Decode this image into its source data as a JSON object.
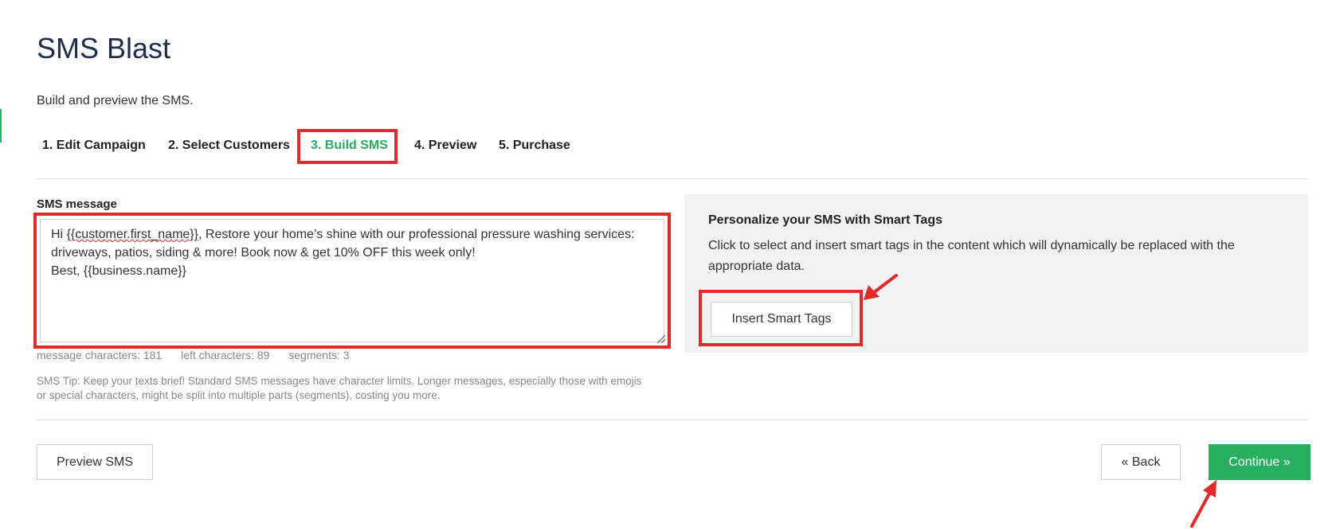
{
  "page": {
    "title": "SMS Blast",
    "subtitle": "Build and preview the SMS."
  },
  "steps": [
    {
      "label": "1. Edit Campaign",
      "active": false
    },
    {
      "label": "2. Select Customers",
      "active": false
    },
    {
      "label": "3. Build SMS",
      "active": true
    },
    {
      "label": "4. Preview",
      "active": false
    },
    {
      "label": "5. Purchase",
      "active": false
    }
  ],
  "sms": {
    "label": "SMS message",
    "message_greeting": "Hi ",
    "message_tag": "{{customer.first_name}}",
    "message_rest": ", Restore your home’s shine with our professional pressure washing services: driveways, patios, siding & more! Book now & get 10% OFF this week only!\nBest, {{business.name}}",
    "counters": {
      "message_characters": "message characters: 181",
      "left_characters": "left characters: 89",
      "segments": "segments: 3"
    },
    "tip": "SMS Tip: Keep your texts brief! Standard SMS messages have character limits. Longer messages, especially those with emojis or special characters, might be split into multiple parts (segments), costing you more."
  },
  "smart_tags": {
    "heading": "Personalize your SMS with Smart Tags",
    "description": "Click to select and insert smart tags in the content which will dynamically be replaced with the appropriate data.",
    "button_label": "Insert Smart Tags"
  },
  "actions": {
    "preview_label": "Preview SMS",
    "back_label": "« Back",
    "continue_label": "Continue »"
  },
  "colors": {
    "accent": "#27ae60",
    "title": "#1f2d4d",
    "annotation": "#e32a2a"
  }
}
